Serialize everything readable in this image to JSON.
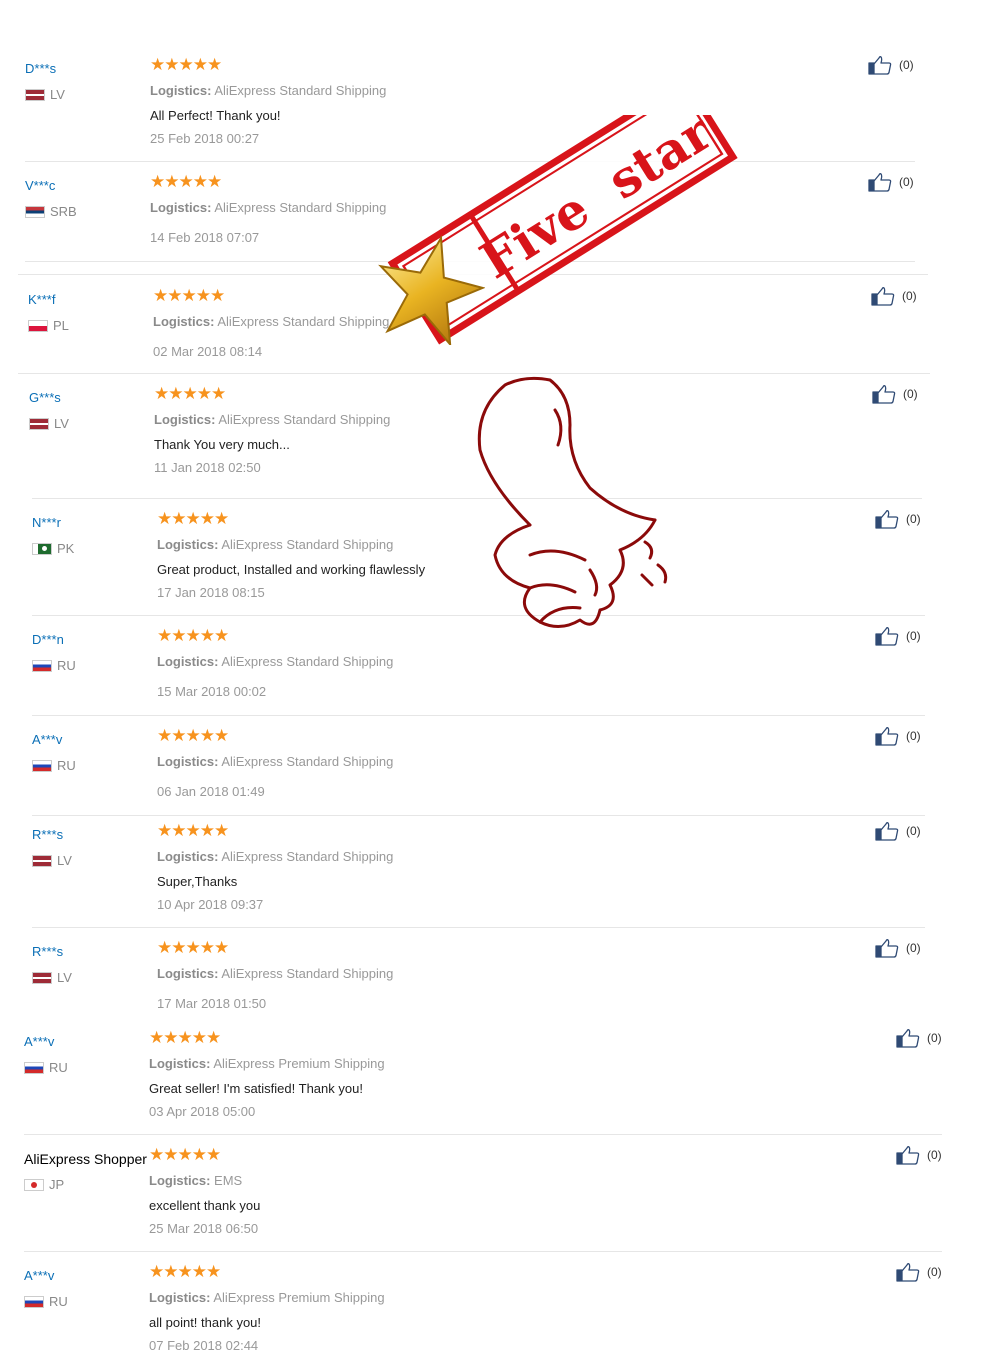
{
  "colors": {
    "user_link": "#0b6fb6",
    "stars": "#f7931e",
    "stamp_red": "#d8141a",
    "thumb_outline": "#8b0a0a"
  },
  "stamp": {
    "text": "Five  star"
  },
  "reviews": [
    {
      "user": "D***s",
      "country": "LV",
      "flag": "lv",
      "stars": "★★★★★",
      "logistics_label": "Logistics:",
      "logistics": "AliExpress Standard Shipping",
      "comment": "All Perfect! Thank you!",
      "date": "25 Feb 2018 00:27",
      "helpful": "(0)"
    },
    {
      "user": "V***c",
      "country": "SRB",
      "flag": "srb",
      "stars": "★★★★★",
      "logistics_label": "Logistics:",
      "logistics": "AliExpress Standard Shipping",
      "comment": "",
      "date": "14 Feb 2018 07:07",
      "helpful": "(0)"
    },
    {
      "user": "K***f",
      "country": "PL",
      "flag": "pl",
      "stars": "★★★★★",
      "logistics_label": "Logistics:",
      "logistics": "AliExpress Standard Shipping",
      "comment": "",
      "date": "02 Mar 2018 08:14",
      "helpful": "(0)"
    },
    {
      "user": "G***s",
      "country": "LV",
      "flag": "lv",
      "stars": "★★★★★",
      "logistics_label": "Logistics:",
      "logistics": "AliExpress Standard Shipping",
      "comment": "Thank You very much...",
      "date": "11 Jan 2018 02:50",
      "helpful": "(0)"
    },
    {
      "user": "N***r",
      "country": "PK",
      "flag": "pk",
      "stars": "★★★★★",
      "logistics_label": "Logistics:",
      "logistics": "AliExpress Standard Shipping",
      "comment": "Great product, Installed and working flawlessly",
      "date": "17 Jan 2018 08:15",
      "helpful": "(0)"
    },
    {
      "user": "D***n",
      "country": "RU",
      "flag": "ru",
      "stars": "★★★★★",
      "logistics_label": "Logistics:",
      "logistics": "AliExpress Standard Shipping",
      "comment": "",
      "date": "15 Mar 2018 00:02",
      "helpful": "(0)"
    },
    {
      "user": "A***v",
      "country": "RU",
      "flag": "ru",
      "stars": "★★★★★",
      "logistics_label": "Logistics:",
      "logistics": "AliExpress Standard Shipping",
      "comment": "",
      "date": "06 Jan 2018 01:49",
      "helpful": "(0)"
    },
    {
      "user": "R***s",
      "country": "LV",
      "flag": "lv",
      "stars": "★★★★★",
      "logistics_label": "Logistics:",
      "logistics": "AliExpress Standard Shipping",
      "comment": "Super,Thanks",
      "date": "10 Apr 2018 09:37",
      "helpful": "(0)"
    },
    {
      "user": "R***s",
      "country": "LV",
      "flag": "lv",
      "stars": "★★★★★",
      "logistics_label": "Logistics:",
      "logistics": "AliExpress Standard Shipping",
      "comment": "",
      "date": "17 Mar 2018 01:50",
      "helpful": "(0)"
    },
    {
      "user": "A***v",
      "country": "RU",
      "flag": "ru",
      "stars": "★★★★★",
      "logistics_label": "Logistics:",
      "logistics": "AliExpress Premium Shipping",
      "comment": "Great seller! I'm satisfied! Thank you!",
      "date": "03 Apr 2018 05:00",
      "helpful": "(0)"
    },
    {
      "user": "AliExpress Shopper",
      "country": "JP",
      "flag": "jp",
      "stars": "★★★★★",
      "logistics_label": "Logistics:",
      "logistics": "EMS",
      "comment": "excellent thank you",
      "date": "25 Mar 2018 06:50",
      "helpful": "(0)"
    },
    {
      "user": "A***v",
      "country": "RU",
      "flag": "ru",
      "stars": "★★★★★",
      "logistics_label": "Logistics:",
      "logistics": "AliExpress Premium Shipping",
      "comment": "all point! thank you!",
      "date": "07 Feb 2018 02:44",
      "helpful": "(0)"
    }
  ]
}
